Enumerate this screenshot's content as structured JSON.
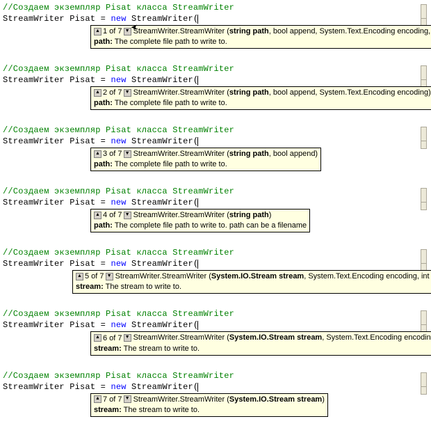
{
  "overloads": [
    {
      "indent": 126,
      "count": "1 of 7",
      "sig_prefix": " StreamWriter.StreamWriter (",
      "sig_bold": "string path",
      "sig_rest": ", bool append, System.Text.Encoding encoding, int bufferSize)",
      "param_name": "path:",
      "param_desc": " The complete file path to write to.",
      "mouse": true
    },
    {
      "indent": 126,
      "count": "2 of 7",
      "sig_prefix": " StreamWriter.StreamWriter (",
      "sig_bold": "string path",
      "sig_rest": ", bool append, System.Text.Encoding encoding)",
      "param_name": "path:",
      "param_desc": " The complete file path to write to."
    },
    {
      "indent": 126,
      "count": "3 of 7",
      "sig_prefix": " StreamWriter.StreamWriter (",
      "sig_bold": "string path",
      "sig_rest": ", bool append)",
      "param_name": "path:",
      "param_desc": " The complete file path to write to."
    },
    {
      "indent": 126,
      "count": "4 of 7",
      "sig_prefix": " StreamWriter.StreamWriter (",
      "sig_bold": "string path",
      "sig_rest": ")",
      "param_name": "path:",
      "param_desc": " The complete file path to write to. path can be a filename"
    },
    {
      "indent": 100,
      "count": "5 of 7",
      "sig_prefix": " StreamWriter.StreamWriter (",
      "sig_bold": "System.IO.Stream stream",
      "sig_rest": ", System.Text.Encoding encoding, int bufferSize)",
      "param_name": "stream:",
      "param_desc": " The stream to write to."
    },
    {
      "indent": 126,
      "count": "6 of 7",
      "sig_prefix": " StreamWriter.StreamWriter (",
      "sig_bold": "System.IO.Stream stream",
      "sig_rest": ", System.Text.Encoding encoding)",
      "param_name": "stream:",
      "param_desc": " The stream to write to."
    },
    {
      "indent": 126,
      "count": "7 of 7",
      "sig_prefix": " StreamWriter.StreamWriter (",
      "sig_bold": "System.IO.Stream stream",
      "sig_rest": ")",
      "param_name": "stream:",
      "param_desc": " The stream to write to."
    }
  ],
  "code": {
    "comment": "//Создаем экземпляр Pisat  класса StreamWriter",
    "line_pre": "StreamWriter Pisat = ",
    "kw": "new",
    "line_post": " StreamWriter("
  },
  "glyphs": {
    "up": "▲",
    "down": "▼"
  }
}
